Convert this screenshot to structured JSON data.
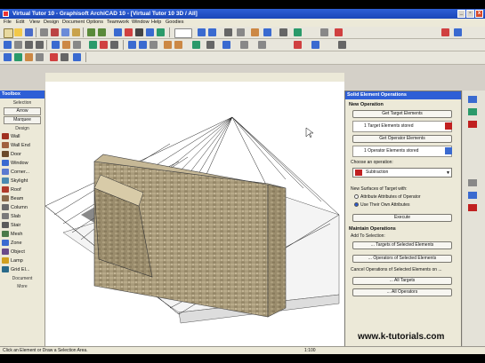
{
  "window": {
    "title": "Virtual Tutor 10 - Graphisoft ArchiCAD 10 - [Virtual Tutor 10 3D / All]",
    "min": "_",
    "max": "▫",
    "close": "x"
  },
  "menu": [
    "File",
    "Edit",
    "View",
    "Design",
    "Document",
    "Options",
    "Teamwork",
    "Window",
    "Help",
    "Goodies"
  ],
  "toolbox": {
    "title": "Toolbox",
    "section_selection": "Selection",
    "arrow": "Arrow",
    "marquee": "Marquee",
    "section_design": "Design",
    "items": [
      "Wall",
      "Wall End",
      "Door",
      "Window",
      "Corner...",
      "Skylight",
      "Roof",
      "Beam",
      "Column",
      "Slab",
      "Stair",
      "Mesh",
      "Zone",
      "Object",
      "Lamp",
      "Grid El..."
    ],
    "section_document": "Document",
    "more": "More"
  },
  "panel": {
    "title": "Solid Element Operations",
    "new_operation": "New Operation",
    "get_targets": "Get Target Elements",
    "targets_stored": "1 Target Elements stored",
    "get_operators": "Get Operator Elements",
    "operators_stored": "1 Operator Elements stored",
    "choose_operation": "Choose an operation:",
    "operation": "Subtraction",
    "new_surfaces": "New Surfaces of Target with:",
    "radio1": "Attribute Attributes of Operator",
    "radio2": "Use Their Own Attributes",
    "execute": "Execute",
    "maintain": "Maintain Operations",
    "add_to_selection": "Add To Selection:",
    "targets_of_selected": "... Targets of Selected Elements",
    "operators_of_selected": "... Operators of Selected Elements",
    "cancel_ops": "Cancel Operations of Selected Elements on ...",
    "all_targets": "... All Targets",
    "all_operators": "... All Operators"
  },
  "status": {
    "hint": "Click an Element or Draw a Selection Area.",
    "scale": "1:100"
  },
  "watermark": "www.k-tutorials.com",
  "colors": {
    "title": "#1b46b8",
    "face": "#ece9d8",
    "brick": "#a89a7a"
  }
}
